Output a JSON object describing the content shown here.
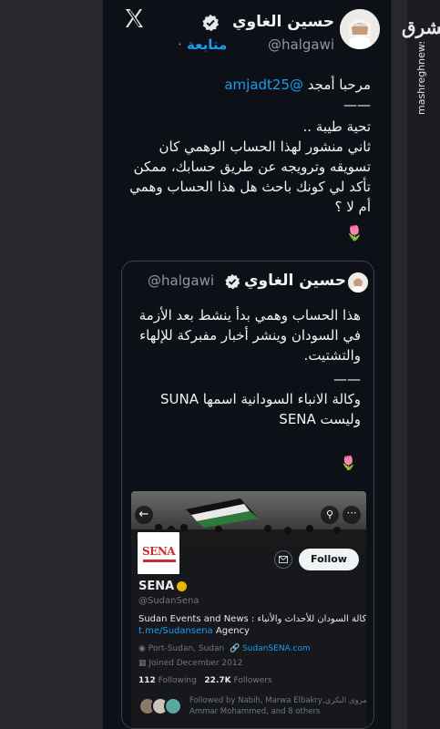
{
  "tweet": {
    "author_name": "حسين الغاوي",
    "author_handle": "@halgawi",
    "follow_label": "متابعة",
    "separator": "·",
    "greeting": "مرحبا أمجد",
    "mention": "@amjadt25",
    "divider": "——",
    "body_lines": [
      "تحية طيبة ..",
      "ثاني منشور لهذا الحساب الوهمي كان",
      "تسويقه وترويجه عن طريق حسابك، ممكن",
      "تأكد لي كونك باحث هل هذا الحساب وهمي",
      "أم لا ؟"
    ],
    "emoji": "🌷"
  },
  "quote": {
    "name": "حسين الغاوي",
    "handle": "@halgawi",
    "lines_a": [
      "هذا الحساب وهمي بدأ ينشط بعد الأزمة",
      "في السودان وينشر أخبار مفبركة للإلهاء",
      "والتشتيت."
    ],
    "divider": "——",
    "lines_b": [
      "وكالة الانباء السودانية اسمها SUNA",
      "وليست SENA"
    ],
    "emoji": "🌷"
  },
  "profile": {
    "logo_text": "SENA",
    "name": "SENA",
    "handle": "@SudanSena",
    "follow_label": "Follow",
    "bio_line1": "Sudan Events and News : وكالة السودان للأحداث والأنباء",
    "bio_link": "t.me/Sudansena",
    "bio_rest": " Agency",
    "location": "Port-Sudan, Sudan",
    "website": "SudanSENA.com",
    "joined": "Joined December 2012",
    "following_count": "112",
    "following_label": "Following",
    "followers_count": "22.7K",
    "followers_label": "Followers",
    "followed_by_line1": "Followed by Nabih, Marwa Elbakry,مروى البكري",
    "followed_by_line2": "Ammar Mohammed, and 8 others"
  },
  "watermark": {
    "logo": "مشرق",
    "url": "mashreghnews.ir"
  },
  "colors": {
    "background": "#0d1117",
    "accent": "#1d9bf0",
    "verified": "#e7e9ea",
    "gold_badge": "#e8b500",
    "sena_red": "#cc2b2b"
  }
}
